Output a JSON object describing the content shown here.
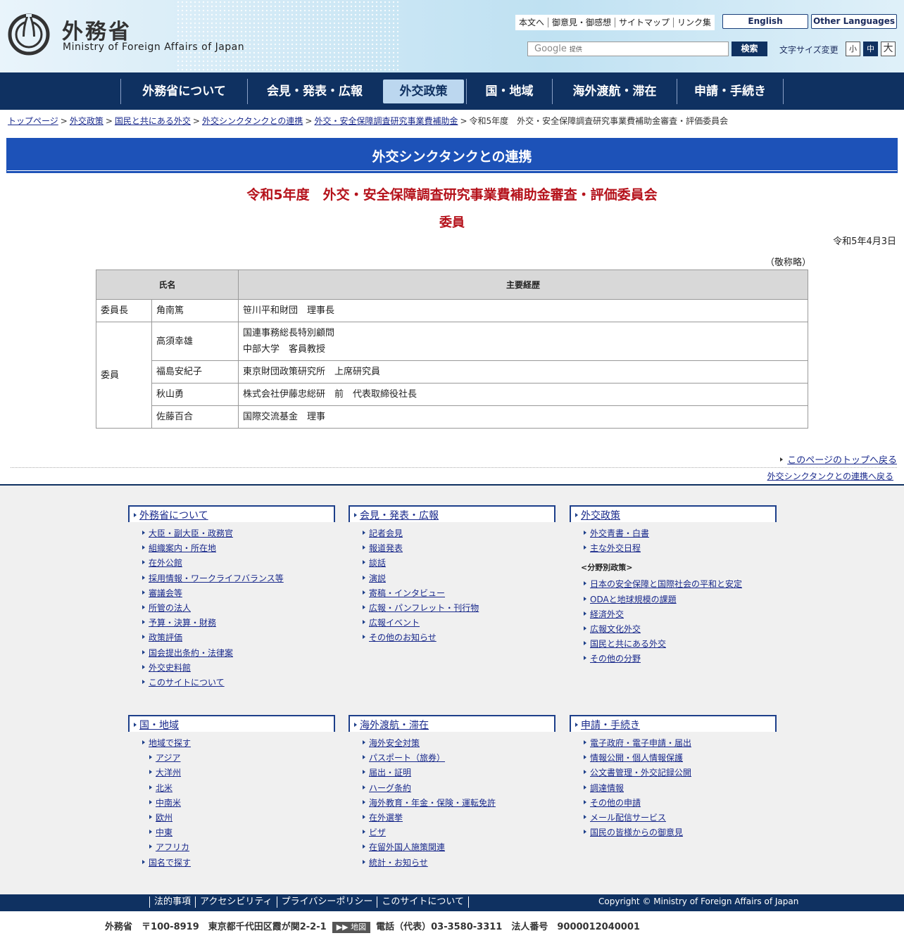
{
  "header": {
    "logo_jp": "外務省",
    "logo_en": "Ministry of Foreign Affairs of Japan",
    "util_links": [
      "本文へ",
      "御意見・御感想",
      "サイトマップ",
      "リンク集"
    ],
    "english": "English",
    "other_languages": "Other Languages",
    "search_brand": "Google",
    "search_provided": "提供",
    "search_button": "検索",
    "fontsize_label": "文字サイズ変更",
    "fontsize": [
      "小",
      "中",
      "大"
    ],
    "fontsize_active": "中"
  },
  "gnav": [
    "外務省について",
    "会見・発表・広報",
    "外交政策",
    "国・地域",
    "海外渡航・滞在",
    "申請・手続き"
  ],
  "gnav_active": "外交政策",
  "breadcrumb": {
    "links": [
      "トップページ",
      "外交政策",
      "国民と共にある外交",
      "外交シンクタンクとの連携",
      "外交・安全保障調査研究事業費補助金"
    ],
    "sep": ">",
    "current": "令和5年度　外交・安全保障調査研究事業費補助金審査・評価委員会"
  },
  "section_title": "外交シンクタンクとの連携",
  "main_title": "令和5年度　外交・安全保障調査研究事業費補助金審査・評価委員会",
  "sub_title": "委員",
  "date": "令和5年4月3日",
  "keisho": "（敬称略）",
  "table": {
    "headers": [
      "氏名",
      "主要経歴"
    ],
    "rows": [
      {
        "role": "委員長",
        "name": "角南篤",
        "career": [
          "笹川平和財団　理事長"
        ]
      },
      {
        "role": "委員",
        "name": "高須幸雄",
        "career": [
          "国連事務総長特別顧問",
          "中部大学　客員教授"
        ]
      },
      {
        "role": "",
        "name": "福島安紀子",
        "career": [
          "東京財団政策研究所　上席研究員"
        ]
      },
      {
        "role": "",
        "name": "秋山勇",
        "career": [
          "株式会社伊藤忠総研　前　代表取締役社長"
        ]
      },
      {
        "role": "",
        "name": "佐藤百合",
        "career": [
          "国際交流基金　理事"
        ]
      }
    ]
  },
  "to_top": "このページのトップへ戻る",
  "back_section": "外交シンクタンクとの連携へ戻る",
  "footer_map": [
    {
      "head": "外務省について",
      "items": [
        "大臣・副大臣・政務官",
        "組織案内・所在地",
        "在外公館",
        "採用情報・ワークライフバランス等",
        "審議会等",
        "所管の法人",
        "予算・決算・財務",
        "政策評価",
        "国会提出条約・法律案",
        "外交史料館",
        "このサイトについて"
      ]
    },
    {
      "head": "会見・発表・広報",
      "items": [
        "記者会見",
        "報道発表",
        "談話",
        "演説",
        "寄稿・インタビュー",
        "広報・パンフレット・刊行物",
        "広報イベント",
        "その他のお知らせ"
      ]
    },
    {
      "head": "外交政策",
      "items": [
        "外交青書・白書",
        "主な外交日程"
      ],
      "category": "<分野別政策>",
      "items2": [
        "日本の安全保障と国際社会の平和と安定",
        "ODAと地球規模の課題",
        "経済外交",
        "広報文化外交",
        "国民と共にある外交",
        "その他の分野"
      ]
    },
    {
      "head": "国・地域",
      "items": [
        "地域で探す"
      ],
      "sub": [
        "アジア",
        "大洋州",
        "北米",
        "中南米",
        "欧州",
        "中東",
        "アフリカ"
      ],
      "items2": [
        "国名で探す"
      ]
    },
    {
      "head": "海外渡航・滞在",
      "items": [
        "海外安全対策",
        "パスポート（旅券）",
        "届出・証明",
        "ハーグ条約",
        "海外教育・年金・保険・運転免許",
        "在外選挙",
        "ビザ",
        "在留外国人施策関連",
        "統計・お知らせ"
      ]
    },
    {
      "head": "申請・手続き",
      "items": [
        "電子政府・電子申請・届出",
        "情報公開・個人情報保護",
        "公文書管理・外交記録公開",
        "調達情報",
        "その他の申請",
        "メール配信サービス",
        "国民の皆様からの御意見"
      ]
    }
  ],
  "footer": {
    "links": [
      "法的事項",
      "アクセシビリティ",
      "プライバシーポリシー",
      "このサイトについて"
    ],
    "copyright": "Copyright © Ministry of Foreign Affairs of Japan",
    "address_pre": "外務省　〒100-8919　東京都千代田区霞が関2-2-1",
    "map": "▶▶ 地図",
    "address_post": "電話（代表）03-3580-3311　法人番号　9000012040001"
  }
}
